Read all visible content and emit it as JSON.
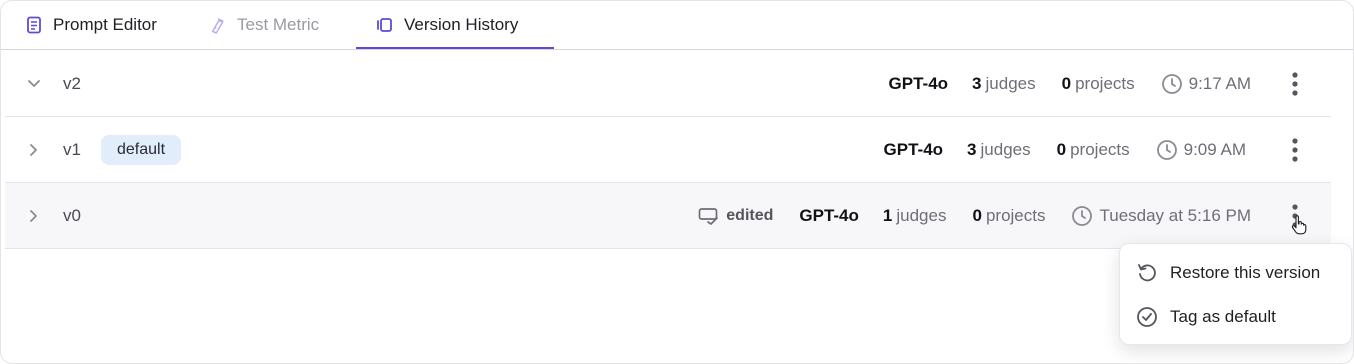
{
  "tabs": [
    {
      "label": "Prompt Editor",
      "icon": "document-icon",
      "active": false
    },
    {
      "label": "Test Metric",
      "icon": "flask-icon",
      "active": false,
      "disabled": true
    },
    {
      "label": "Version History",
      "icon": "versions-icon",
      "active": true
    }
  ],
  "versions": [
    {
      "version": "v2",
      "model": "GPT-4o",
      "judges_count": "3",
      "judges_label": "judges",
      "projects_count": "0",
      "projects_label": "projects",
      "time": "9:17 AM",
      "expanded": true
    },
    {
      "version": "v1",
      "badge": "default",
      "model": "GPT-4o",
      "judges_count": "3",
      "judges_label": "judges",
      "projects_count": "0",
      "projects_label": "projects",
      "time": "9:09 AM"
    },
    {
      "version": "v0",
      "edited_label": "edited",
      "model": "GPT-4o",
      "judges_count": "1",
      "judges_label": "judges",
      "projects_count": "0",
      "projects_label": "projects",
      "time": "Tuesday at 5:16 PM"
    }
  ],
  "menu": {
    "restore_label": "Restore this version",
    "tag_default_label": "Tag as default"
  },
  "colors": {
    "accent": "#5b4bd6",
    "badge_bg": "#e1edfb",
    "hover_row": "#f7f7f9"
  }
}
